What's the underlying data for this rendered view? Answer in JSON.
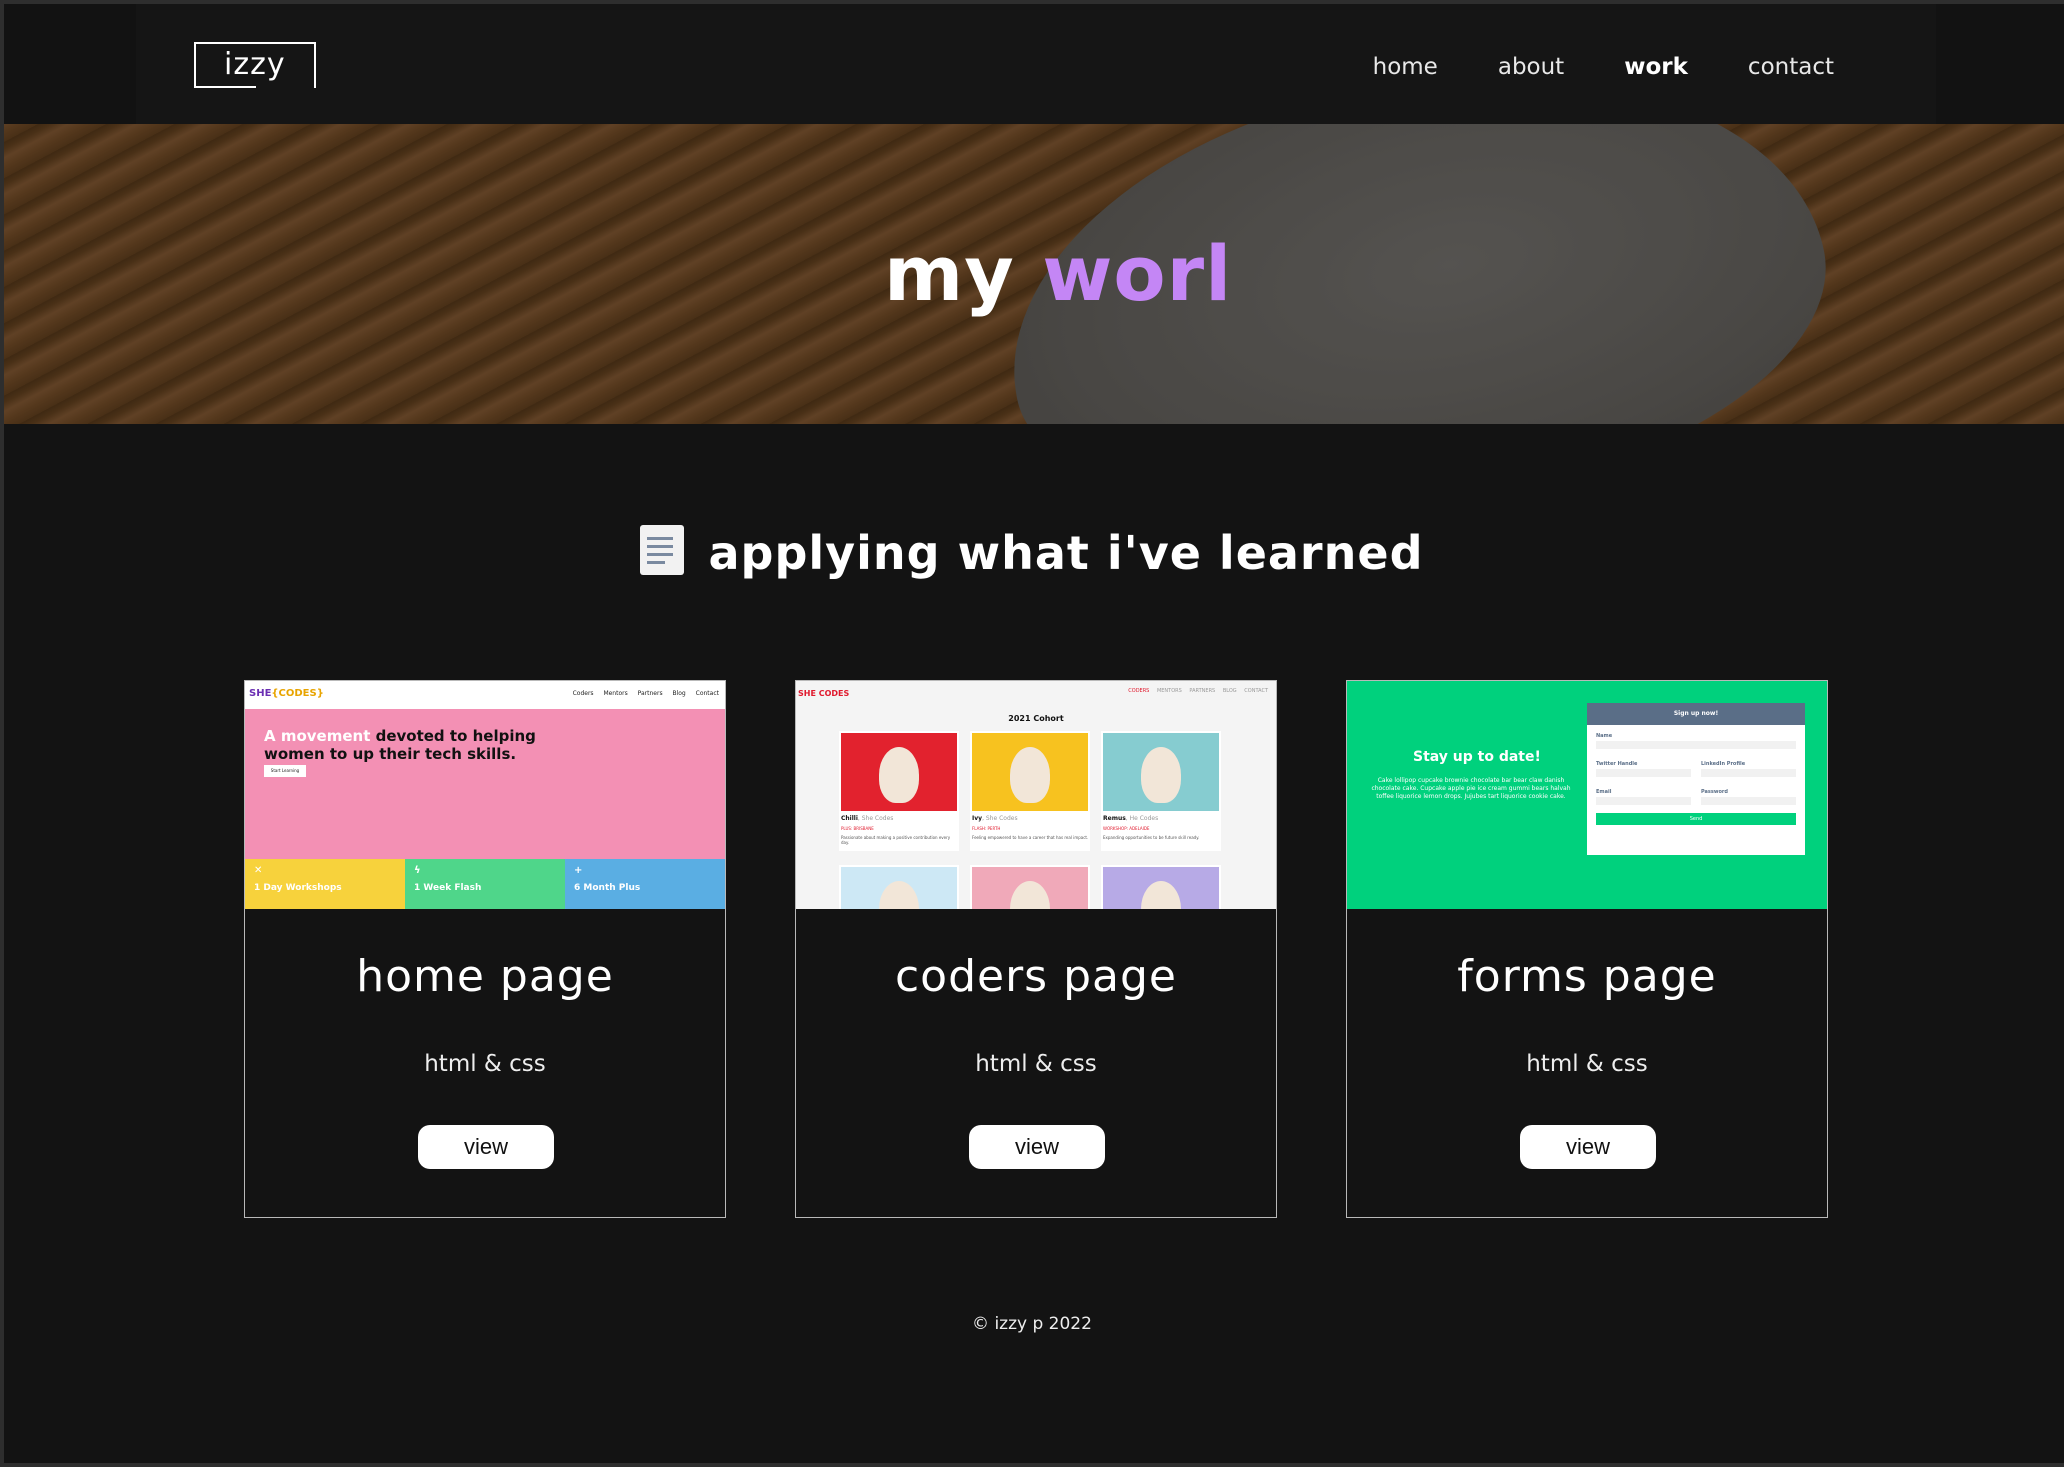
{
  "header": {
    "logo": "izzy",
    "nav": [
      {
        "label": "home",
        "active": false
      },
      {
        "label": "about",
        "active": false
      },
      {
        "label": "work",
        "active": true
      },
      {
        "label": "contact",
        "active": false
      }
    ]
  },
  "hero": {
    "title_plain": "my ",
    "title_accent": "worl",
    "accent_color": "#c486f5"
  },
  "section": {
    "title": "applying what i've learned",
    "icon": "memo-icon"
  },
  "projects": [
    {
      "title": "home page",
      "tech": "html & css",
      "button": "view",
      "thumb": {
        "brand": "SHE",
        "brand_accent": "{CODES}",
        "links": "Coders Mentors Partners Blog Contact",
        "headline_highlight": "A movement",
        "headline_rest": " devoted to helping women to up their tech skills.",
        "cta": "Start Learning",
        "tiles": [
          {
            "icon": "✕",
            "label": "1 Day Workshops"
          },
          {
            "icon": "ϟ",
            "label": "1 Week Flash"
          },
          {
            "icon": "+",
            "label": "6 Month Plus"
          }
        ]
      }
    },
    {
      "title": "coders page",
      "tech": "html & css",
      "button": "view",
      "thumb": {
        "brand": "SHE CODES",
        "links": [
          "CODERS",
          "MENTORS",
          "PARTNERS",
          "BLOG",
          "CONTACT"
        ],
        "cohort": "2021 Cohort",
        "dogs": [
          {
            "name": "Chilli",
            "org": ", She Codes",
            "tag": "PLUS: BRISBANE",
            "desc": "Passionate about making a positive contribution every day.",
            "color": "#e2222e"
          },
          {
            "name": "Ivy",
            "org": ", She Codes",
            "tag": "FLASH: PERTH",
            "desc": "Feeling empowered to have a career that has real impact.",
            "color": "#f7c21f"
          },
          {
            "name": "Remus",
            "org": ", He Codes",
            "tag": "WORKSHOP: ADELAIDE",
            "desc": "Expanding opportunities to be future skill ready.",
            "color": "#86ccd0"
          },
          {
            "name": "",
            "org": "",
            "tag": "",
            "desc": "",
            "color": "#cde8f5"
          },
          {
            "name": "",
            "org": "",
            "tag": "",
            "desc": "",
            "color": "#f0a9b9"
          },
          {
            "name": "",
            "org": "",
            "tag": "",
            "desc": "",
            "color": "#b7aae6"
          }
        ]
      }
    },
    {
      "title": "forms page",
      "tech": "html & css",
      "button": "view",
      "thumb": {
        "heading": "Stay up to date!",
        "blurb": "Cake lollipop cupcake brownie chocolate bar bear claw danish chocolate cake. Cupcake apple pie ice cream gummi bears halvah toffee liquorice lemon drops. Jujubes tart liquorice cookie cake.",
        "form_title": "Sign up now!",
        "fields": [
          "Name",
          "Twitter Handle",
          "LinkedIn Profile",
          "Email",
          "Password"
        ],
        "submit": "Send"
      }
    }
  ],
  "footer": {
    "text": "© izzy p 2022"
  }
}
